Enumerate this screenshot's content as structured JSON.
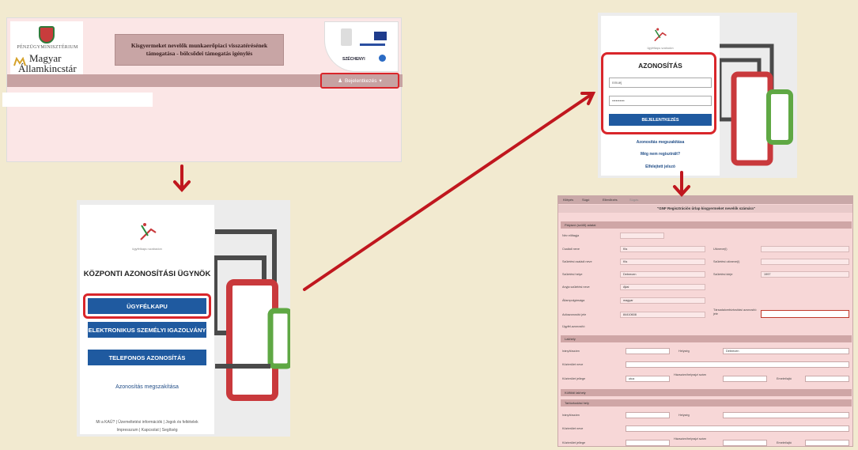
{
  "panel1": {
    "ministry": "PÉNZÜGYMINISZTÉRIUM",
    "brand_line1": "Magyar",
    "brand_line2": "Államkincstár",
    "title": "Kisgyermeket nevelők munkaerőpiaci visszatérésének támogatása - bölcsődei támogatás igénylés",
    "eu_label": "SZÉCHENYI",
    "login_label": "Bejelentkezés"
  },
  "panel2": {
    "logo_sub": "ügyfélkapu szabadon",
    "heading": "KÖZPONTI AZONOSÍTÁSI ÜGYNÖK",
    "buttons": [
      "ÜGYFÉLKAPU",
      "ELEKTRONIKUS SZEMÉLYI IGAZOLVÁNY",
      "TELEFONOS AZONOSÍTÁS"
    ],
    "abort": "Azonosítás megszakítása",
    "footer_line1": "Mi a KAÜ? | Üzemeltetési információk | Jogok és feltételek",
    "footer_line2": "Impresszum | Kapcsolat | Segítség"
  },
  "panel3": {
    "logo_sub": "ügyfélkapu szabadon",
    "heading": "AZONOSÍTÁS",
    "username_value": "nmuej",
    "password_value": "••••••••••",
    "login_button": "BEJELENTKEZÉS",
    "links": [
      "Azonosítás megszakítása",
      "Még nem regisztrált?",
      "Elfelejtett jelszó"
    ]
  },
  "panel4": {
    "tabs": [
      "Kilépés",
      "Súgó",
      "Ellenőrzés",
      "Súgás"
    ],
    "form_title": "\"GNF Regisztrációs űrlap kisgyermeket nevelők számára\"",
    "sections": {
      "applicant": "Pályázó (szülő) adatai",
      "residence": "Lakhely",
      "abroad": "Külföldi lakhely",
      "stay": "Tartózkodási hely"
    },
    "labels": {
      "nem": "Név előtagja",
      "csaladi": "Családi neve",
      "szul_csaladi": "Születési családi neve",
      "szul_hely": "Születési helye",
      "anyja": "Anyja születési neve",
      "allampolg": "Állampolgársága",
      "adoazon": "Adóazonosító jele",
      "ugyfel": "Ügyfél-azonosító",
      "utonev": "Utóneve(i)",
      "szul_utonev": "Születési utóneve(i)",
      "szul_ido": "Születési ideje",
      "taj": "Társadalombiztosítási azonosító jele",
      "irsz": "Irányítószám",
      "helyseg": "Helység",
      "kozterulet": "Közterület neve",
      "jelleg": "Közterület jellege",
      "hazszam": "Házszám/helyrajzi szám",
      "emelet": "Emelet/ajtó"
    },
    "values": {
      "csaladi": "Kis",
      "szul_csaladi": "Kis",
      "szul_hely": "Debrecen",
      "anyja": "Ajtai",
      "allampolg": "magyar",
      "adoazon": "84410608",
      "szul_ido": "1997",
      "helyseg": "Debrecen",
      "jelleg": "utca"
    }
  },
  "colors": {
    "highlight": "#d9262b",
    "button_blue": "#1f5aa0",
    "arrow": "#c0171e",
    "device_red": "#c9393c",
    "device_green": "#5fa844"
  }
}
